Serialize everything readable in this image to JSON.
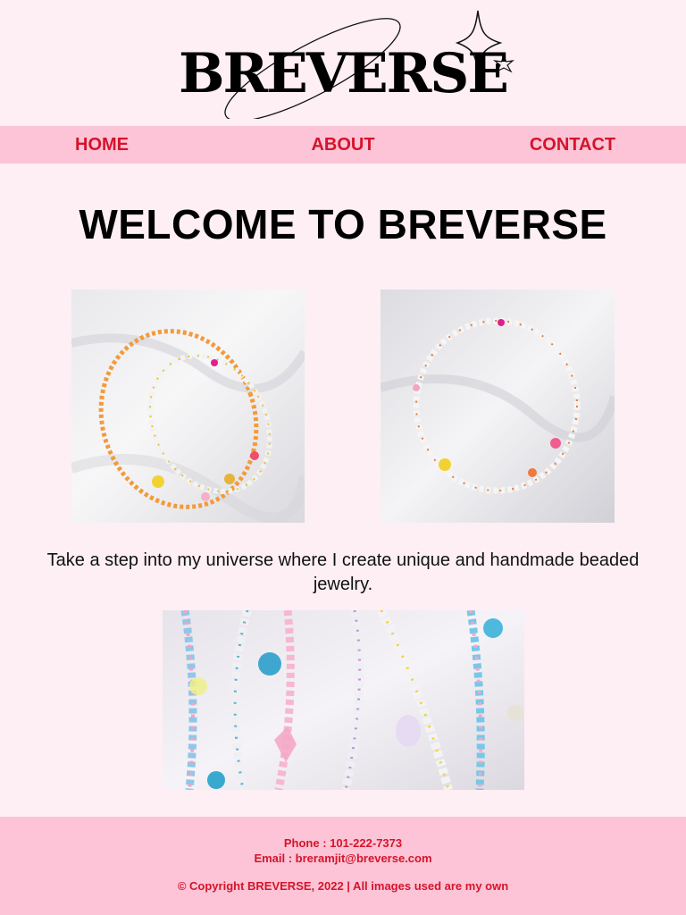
{
  "brand": {
    "logo_text": "BREVERSE"
  },
  "nav": {
    "home": "HOME",
    "about": "ABOUT",
    "contact": "CONTACT"
  },
  "main": {
    "headline": "WELCOME TO BREVERSE",
    "intro": "Take a step into my universe where I create unique and handmade beaded jewelry."
  },
  "footer": {
    "phone": "Phone : 101-222-7373",
    "email": "Email : breramjit@breverse.com",
    "copyright": "© Copyright BREVERSE, 2022 | All images used are my own"
  },
  "colors": {
    "background": "#fdeff4",
    "band": "#fcc4d6",
    "accent": "#d4142b"
  },
  "icons": [
    "sparkle-star-icon",
    "small-star-icon",
    "orbit-ring-icon"
  ]
}
